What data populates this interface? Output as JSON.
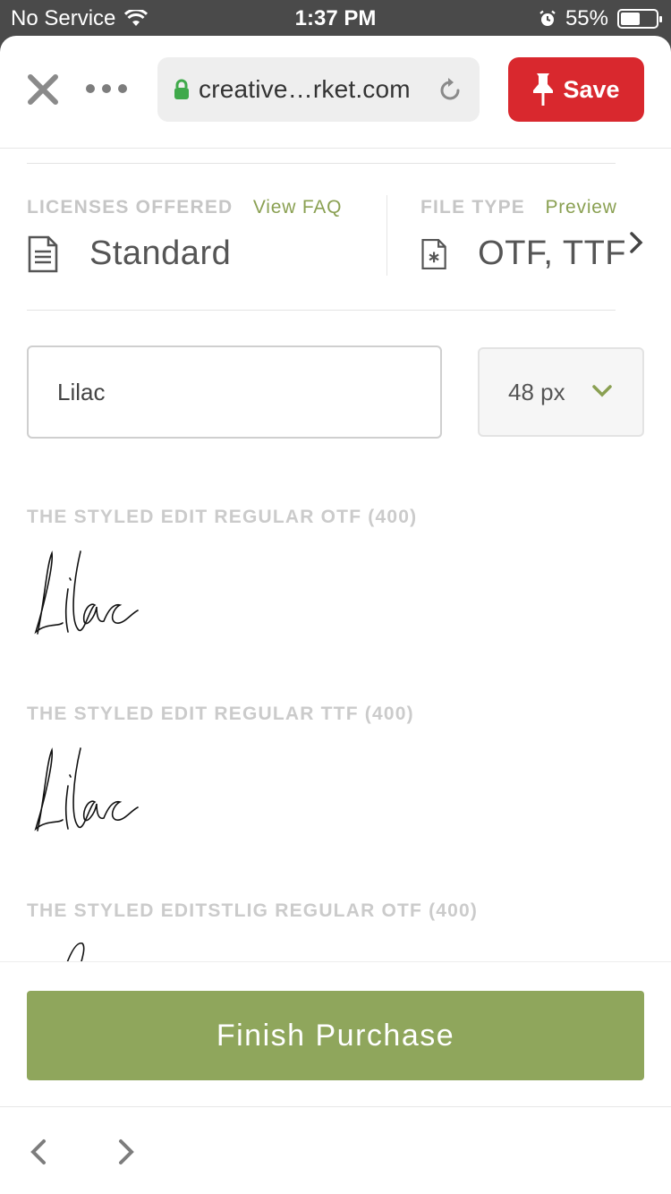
{
  "status_bar": {
    "carrier": "No Service",
    "time": "1:37 PM",
    "battery": "55%",
    "battery_level": 0.55
  },
  "toolbar": {
    "url": "creative…rket.com",
    "save_label": "Save"
  },
  "licenses": {
    "heading": "LICENSES OFFERED",
    "link": "View FAQ",
    "value": "Standard"
  },
  "file_type": {
    "heading": "FILE TYPE",
    "link": "Preview",
    "value": "OTF, TTF"
  },
  "preview_controls": {
    "text_value": "Lilac",
    "size_value": "48 px"
  },
  "styles": [
    {
      "name": "THE STYLED EDIT REGULAR OTF (400)",
      "sample": "Lilac"
    },
    {
      "name": "THE STYLED EDIT REGULAR TTF (400)",
      "sample": "Lilac"
    },
    {
      "name": "THE STYLED EDITSTLIG REGULAR OTF (400)",
      "sample": "Lilac"
    }
  ],
  "purchase": {
    "label": "Finish Purchase"
  },
  "colors": {
    "accent_green": "#8fa65c",
    "save_red": "#d9282e",
    "lock_green": "#3fa94a"
  },
  "icons": {
    "close": "close-icon",
    "more": "more-icon",
    "lock": "lock-icon",
    "reload": "reload-icon",
    "pin": "pin-icon",
    "document": "document-icon",
    "file_asterisk": "file-asterisk-icon",
    "chevron_right": "chevron-right-icon",
    "chevron_down": "chevron-down-icon",
    "back": "back-arrow-icon",
    "forward": "forward-arrow-icon"
  }
}
